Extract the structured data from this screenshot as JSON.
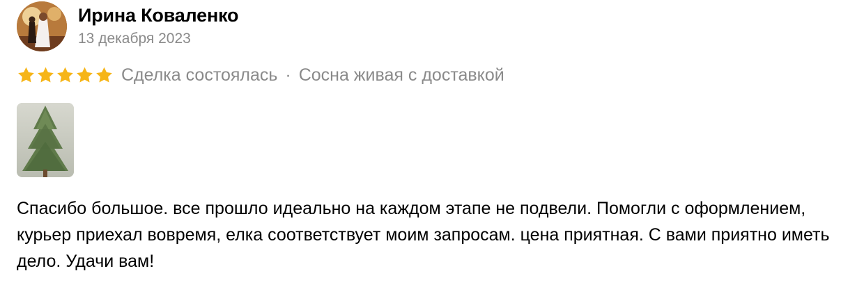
{
  "review": {
    "author": "Ирина Коваленко",
    "date": "13 декабря 2023",
    "rating": 5,
    "rating_max": 5,
    "deal_status": "Сделка состоялась",
    "separator": "·",
    "item": "Сосна живая с доставкой",
    "text": "Спасибо большое. все прошло идеально на каждом этапе не подвели. Помогли с оформлением, курьер приехал вовремя, елка соответствует моим запросам. цена приятная. С вами приятно иметь дело. Удачи вам!"
  },
  "colors": {
    "star": "#f6b518",
    "muted_text": "#8a8a8a",
    "text": "#000000"
  },
  "icons": {
    "avatar": "user-photo",
    "star": "star-icon",
    "photo": "pine-tree-photo"
  }
}
